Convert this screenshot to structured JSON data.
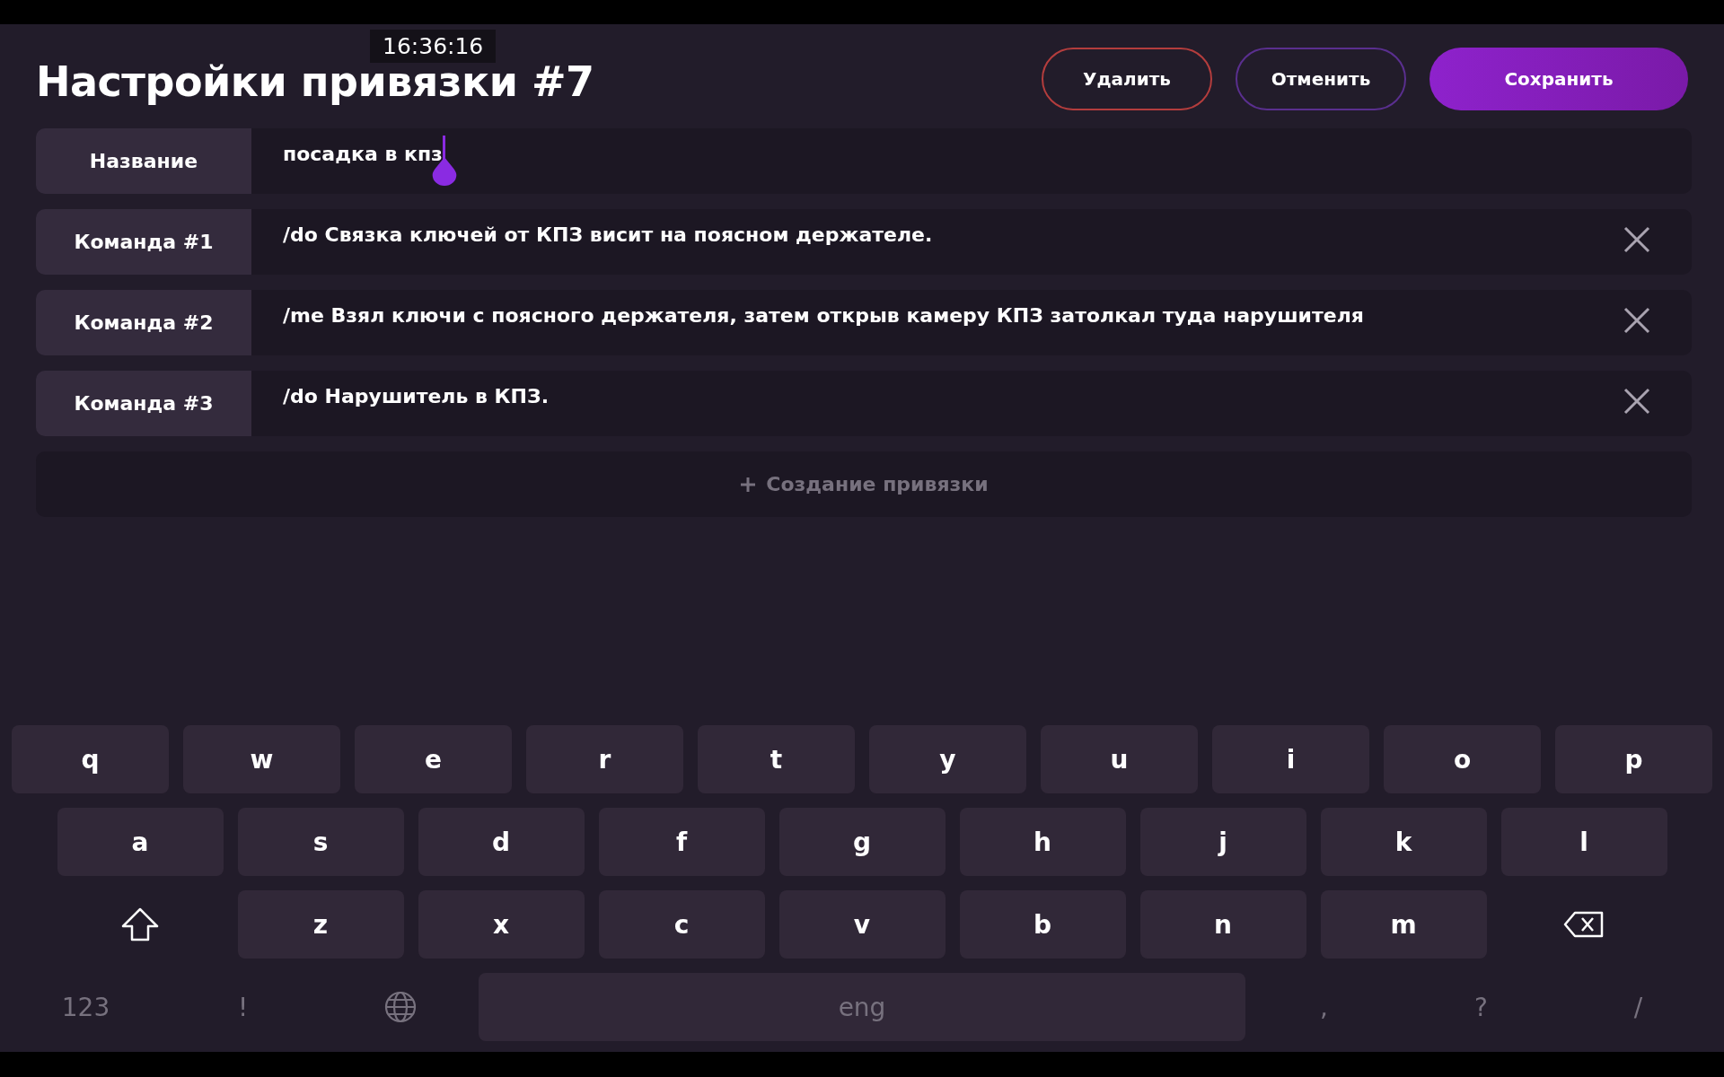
{
  "time": "16:36:16",
  "title": "Настройки привязки #7",
  "buttons": [
    {
      "label": "Удалить",
      "kind": "delete"
    },
    {
      "label": "Отменить",
      "kind": "cancel"
    },
    {
      "label": "Сохранить",
      "kind": "save"
    }
  ],
  "fields": [
    {
      "label": "Название",
      "value": "посадка в кпз",
      "focused": true,
      "removable": false
    },
    {
      "label": "Команда #1",
      "value": "/do Связка ключей от КПЗ висит на поясном держателе.",
      "focused": false,
      "removable": true
    },
    {
      "label": "Команда #2",
      "value": "/me Взял ключи с поясного держателя, затем открыв камеру КПЗ затолкал туда нарушителя",
      "focused": false,
      "removable": true
    },
    {
      "label": "Команда #3",
      "value": "/do Нарушитель в КПЗ.",
      "focused": false,
      "removable": true
    }
  ],
  "add_button": {
    "label": "Создание привязки"
  },
  "keyboard": {
    "rows": [
      [
        {
          "kind": "letter",
          "label": "q"
        },
        {
          "kind": "letter",
          "label": "w"
        },
        {
          "kind": "letter",
          "label": "e"
        },
        {
          "kind": "letter",
          "label": "r"
        },
        {
          "kind": "letter",
          "label": "t"
        },
        {
          "kind": "letter",
          "label": "y"
        },
        {
          "kind": "letter",
          "label": "u"
        },
        {
          "kind": "letter",
          "label": "i"
        },
        {
          "kind": "letter",
          "label": "o"
        },
        {
          "kind": "letter",
          "label": "p"
        }
      ],
      [
        {
          "kind": "letter",
          "label": "a"
        },
        {
          "kind": "letter",
          "label": "s"
        },
        {
          "kind": "letter",
          "label": "d"
        },
        {
          "kind": "letter",
          "label": "f"
        },
        {
          "kind": "letter",
          "label": "g"
        },
        {
          "kind": "letter",
          "label": "h"
        },
        {
          "kind": "letter",
          "label": "j"
        },
        {
          "kind": "letter",
          "label": "k"
        },
        {
          "kind": "letter",
          "label": "l"
        }
      ],
      [
        {
          "kind": "shift"
        },
        {
          "kind": "letter",
          "label": "z"
        },
        {
          "kind": "letter",
          "label": "x"
        },
        {
          "kind": "letter",
          "label": "c"
        },
        {
          "kind": "letter",
          "label": "v"
        },
        {
          "kind": "letter",
          "label": "b"
        },
        {
          "kind": "letter",
          "label": "n"
        },
        {
          "kind": "letter",
          "label": "m"
        },
        {
          "kind": "backspace"
        }
      ]
    ],
    "bottom_row": [
      {
        "kind": "symbol",
        "label": "123"
      },
      {
        "kind": "symbol",
        "label": "!"
      },
      {
        "kind": "globe"
      },
      {
        "kind": "space",
        "label": "eng"
      },
      {
        "kind": "symbol",
        "label": ","
      },
      {
        "kind": "symbol",
        "label": "?"
      },
      {
        "kind": "symbol",
        "label": "/"
      }
    ]
  }
}
